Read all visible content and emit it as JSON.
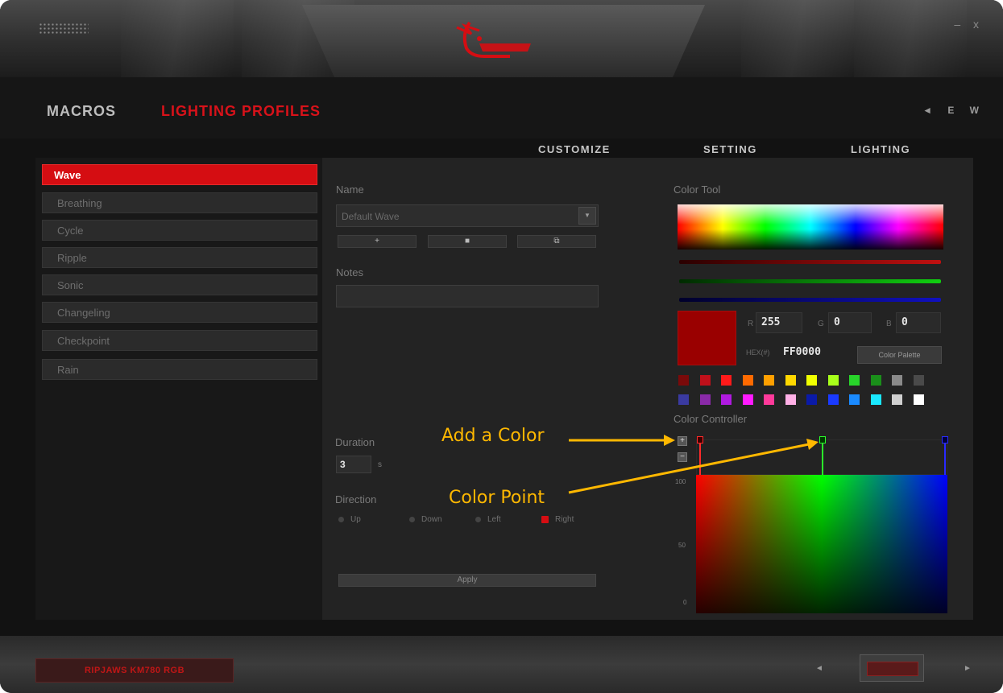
{
  "window": {
    "controls": "– x"
  },
  "nav": {
    "macros": "MACROS",
    "lighting_profiles": "LIGHTING PROFILES",
    "right_icons": "◄ E W"
  },
  "subtabs": [
    "CUSTOMIZE",
    "SETTING",
    "LIGHTING"
  ],
  "profiles": [
    "Wave",
    "Breathing",
    "Cycle",
    "Ripple",
    "Sonic",
    "Changeling",
    "Checkpoint",
    "Rain"
  ],
  "editor": {
    "name_label": "Name",
    "name_value": "Default Wave",
    "add_symbol": "+",
    "delete_symbol": "■",
    "copy_symbol": "⧉",
    "notes_label": "Notes",
    "notes_value": "",
    "duration_label": "Duration",
    "duration_value": "3",
    "duration_unit": "s",
    "direction_label": "Direction",
    "directions": [
      "Up",
      "Down",
      "Left",
      "Right"
    ],
    "selected_direction": "Right",
    "apply_label": "Apply"
  },
  "color_tool": {
    "title": "Color Tool",
    "r_label": "R",
    "r_value": "255",
    "g_label": "G",
    "g_value": "0",
    "b_label": "B",
    "b_value": "0",
    "hex_label": "HEX(#)",
    "hex_value": "FF0000",
    "palette_button": "Color Palette",
    "current_color": "#9a0000",
    "palette_row1": [
      "#7a0a0a",
      "#c0101a",
      "#ff1a1a",
      "#ff6a00",
      "#ffa000",
      "#ffd800",
      "#f0ff00",
      "#a8ff1a",
      "#28d42a",
      "#1a8f1a",
      "#8a8a8a",
      "#4a4a4a"
    ],
    "palette_row2": [
      "#3a3aa0",
      "#8a2aa8",
      "#b01ae0",
      "#ff1aff",
      "#ff3a9a",
      "#ffb0e6",
      "#0a1aa8",
      "#1a3aff",
      "#1a8aff",
      "#1ae8ff",
      "#d0d0d0",
      "#ffffff"
    ]
  },
  "color_controller": {
    "title": "Color Controller",
    "add_button": "+",
    "remove_button": "−",
    "y_labels": [
      "100",
      "50",
      "0"
    ],
    "point_colors": [
      "#ff2a2a",
      "#2aff2a",
      "#2a2aff"
    ]
  },
  "annotations": {
    "add_color": "Add a Color",
    "color_point": "Color Point"
  },
  "footer": {
    "device_name": "RIPJAWS KM780 RGB",
    "prev": "◄",
    "next": "►"
  }
}
